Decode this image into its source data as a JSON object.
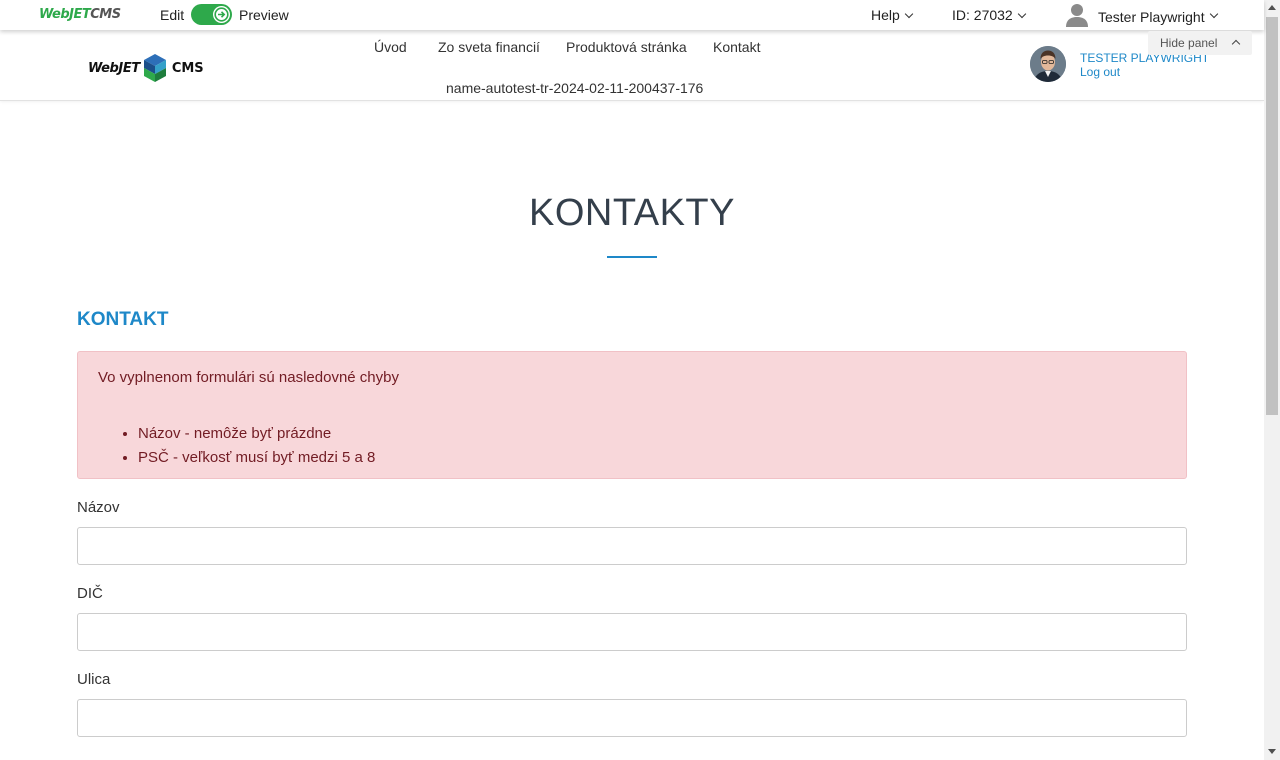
{
  "admin_bar": {
    "logo_part1": "WebJET",
    "logo_part2": "CMS",
    "edit_label": "Edit",
    "preview_label": "Preview",
    "help_label": "Help",
    "id_label": "ID: 27032",
    "user_name": "Tester Playwright",
    "toggle_on": true,
    "accent_color": "#2ea94b"
  },
  "site_header": {
    "logo_part1": "WebJET",
    "logo_part2": "CMS",
    "nav": [
      "Úvod",
      "Zo sveta financií",
      "Produktová stránka",
      "Kontakt"
    ],
    "nav_sub": "name-autotest-tr-2024-02-11-200437-176",
    "user_name": "Tester Playwright",
    "logout_label": "Log out",
    "hide_panel_label": "Hide panel"
  },
  "main": {
    "title": "KONTAKTY",
    "section_heading": "KONTAKT",
    "alert": {
      "message": "Vo vyplnenom formulári sú nasledovné chyby",
      "errors": [
        "Názov - nemôže byť prázdne",
        "PSČ - veľkosť musí byť medzi 5 a 8"
      ]
    },
    "fields": [
      {
        "label": "Názov",
        "value": "",
        "placeholder": ""
      },
      {
        "label": "DIČ",
        "value": "",
        "placeholder": ""
      },
      {
        "label": "Ulica",
        "value": "",
        "placeholder": ""
      }
    ]
  },
  "colors": {
    "link_blue": "#1e88c8",
    "alert_bg": "#f8d7da",
    "alert_text": "#721c24",
    "title_color": "#343f4b"
  }
}
